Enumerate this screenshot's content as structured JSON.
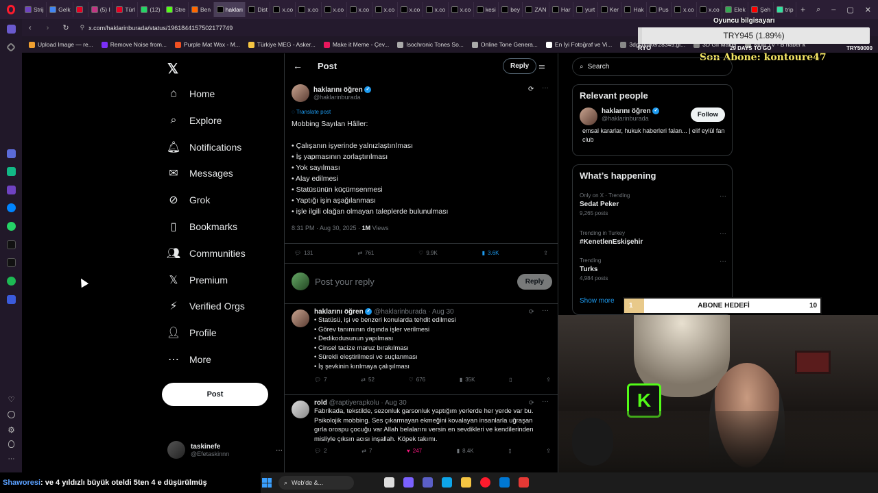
{
  "browser": {
    "tabs": [
      {
        "label": "Strij",
        "color": "#6f42c1"
      },
      {
        "label": "Gelk",
        "color": "#4285f4"
      },
      {
        "label": "",
        "color": "#e60023"
      },
      {
        "label": "(5) I",
        "color": "#c13584"
      },
      {
        "label": "Türl",
        "color": "#e60023"
      },
      {
        "label": "(12)",
        "color": "#25d366"
      },
      {
        "label": "Stre",
        "color": "#53fc18"
      },
      {
        "label": "Ben",
        "color": "#ff6600"
      },
      {
        "label": "hakları",
        "color": "#000000",
        "active": true
      },
      {
        "label": "Dist",
        "color": "#000000"
      },
      {
        "label": "x.co",
        "color": "#000000"
      },
      {
        "label": "x.co",
        "color": "#000000"
      },
      {
        "label": "x.co",
        "color": "#000000"
      },
      {
        "label": "x.co",
        "color": "#000000"
      },
      {
        "label": "x.co",
        "color": "#000000"
      },
      {
        "label": "x.co",
        "color": "#000000"
      },
      {
        "label": "x.co",
        "color": "#000000"
      },
      {
        "label": "x.co",
        "color": "#000000"
      },
      {
        "label": "kesi",
        "color": "#000000"
      },
      {
        "label": "bey",
        "color": "#000000"
      },
      {
        "label": "ZAN",
        "color": "#000000"
      },
      {
        "label": "Har",
        "color": "#000000"
      },
      {
        "label": "yurt",
        "color": "#000000"
      },
      {
        "label": "Ker",
        "color": "#000000"
      },
      {
        "label": "Hak",
        "color": "#000000"
      },
      {
        "label": "Pus",
        "color": "#000000"
      },
      {
        "label": "x.co",
        "color": "#000000"
      },
      {
        "label": "x.co",
        "color": "#000000"
      },
      {
        "label": "Elek",
        "color": "#34a853"
      },
      {
        "label": "Şeh",
        "color": "#ff0000"
      },
      {
        "label": "trip",
        "color": "#34e0a1"
      }
    ],
    "url": "x.com/haklarinburada/status/1961844157502177749",
    "bookmarks": [
      {
        "label": "Upload Image — re...",
        "color": "#f0a030"
      },
      {
        "label": "Remove Noise from...",
        "color": "#7b2ff7"
      },
      {
        "label": "Purple Mat Wax - M...",
        "color": "#f25022"
      },
      {
        "label": "Türkiye MEG - Asker...",
        "color": "#f5c542"
      },
      {
        "label": "Make it Meme - Çev...",
        "color": "#e8175d"
      },
      {
        "label": "Isochronic Tones So...",
        "color": "#aaaaaa"
      },
      {
        "label": "Online Tone Genera...",
        "color": "#aaaaaa"
      },
      {
        "label": "En İyi Fotoğraf ve Vi...",
        "color": "#ffffff"
      },
      {
        "label": "3dgifmaker28349.gi...",
        "color": "#888888"
      },
      {
        "label": "3D Gif Maker",
        "color": "#888888"
      },
      {
        "label": "Multi TV - B haber k",
        "color": "#888888"
      }
    ]
  },
  "overlay": {
    "computer_label": "Oyuncu bilgisayarı",
    "goal_value": "TRY945 (1.89%)",
    "goal_left": "RYO",
    "goal_days": "29 DAYS TO GO",
    "goal_right": "TRY50000",
    "goal_progress": 0.0189,
    "last_sub": "Son Abone: kontoure47",
    "sub_goal_current": "1",
    "sub_goal_label": "ABONE HEDEFİ",
    "sub_goal_target": "10",
    "sub_goal_progress": 0.1
  },
  "nav": {
    "items": [
      {
        "label": "Home",
        "icon": "home-icon"
      },
      {
        "label": "Explore",
        "icon": "search-icon"
      },
      {
        "label": "Notifications",
        "icon": "bell-icon"
      },
      {
        "label": "Messages",
        "icon": "mail-icon"
      },
      {
        "label": "Grok",
        "icon": "grok-icon"
      },
      {
        "label": "Bookmarks",
        "icon": "bookmark-icon"
      },
      {
        "label": "Communities",
        "icon": "people-icon"
      },
      {
        "label": "Premium",
        "icon": "x-logo-icon"
      },
      {
        "label": "Verified Orgs",
        "icon": "bolt-icon"
      },
      {
        "label": "Profile",
        "icon": "person-icon"
      },
      {
        "label": "More",
        "icon": "more-circle-icon"
      }
    ],
    "post_button": "Post",
    "account_name": "taskinefe",
    "account_handle": "@Efetaskinnn"
  },
  "main": {
    "header_title": "Post",
    "reply_button": "Reply",
    "post": {
      "author": "haklarını öğren",
      "handle": "@haklarinburada",
      "translate": "Translate post",
      "lines": [
        "Mobbing Sayılan Hâller:",
        "",
        "• Çalışanın işyerinde yalnızlaştırılması",
        "• İş yapmasının zorlaştırılması",
        "• Yok sayılması",
        "• Alay edilmesi",
        "• Statüsünün küçümsenmesi",
        "• Yaptığı işin aşağılanması",
        "• işle ilgili olağan olmayan taleplerde bulunulması"
      ],
      "time": "8:31 PM · Aug 30, 2025 · ",
      "views_count": "1M",
      "views_label": " Views",
      "replies": "131",
      "reposts": "761",
      "likes": "9.9K",
      "bookmarks": "3.6K"
    },
    "compose_placeholder": "Post your reply",
    "compose_button": "Reply",
    "replies": [
      {
        "author": "haklarını öğren",
        "handle": "@haklarinburada · Aug 30",
        "verified": true,
        "lines": [
          "• Statüsü, işi ve benzeri konularda tehdit edilmesi",
          "• Görev tanımının dışında işler verilmesi",
          "• Dedikodusunun yapılması",
          "• Cinsel tacize maruz bırakılması",
          "• Sürekli eleştirilmesi ve suçlanması",
          "• İş şevkinin kırılmaya çalışılması"
        ],
        "replies": "7",
        "reposts": "52",
        "likes": "676",
        "views": "35K"
      },
      {
        "author": "rold",
        "handle": "@raptiyerapkolu · Aug 30",
        "verified": false,
        "lines": [
          "Fabrikada, tekstilde, sezonluk garsonluk yaptığım yerlerde her yerde var bu.",
          "Psikolojik mobbing. Ses çıkarmayan ekmeğini kovalayan insanlarla uğraşan",
          "gırla orospu çocuğu var Allah belalarını versin en sevdikleri ve kendilerinden",
          "misliyle çıksın acısı inşallah. Köpek takımı."
        ],
        "replies": "2",
        "reposts": "7",
        "likes": "247",
        "views": "8.4K"
      }
    ]
  },
  "right": {
    "search_placeholder": "Search",
    "relevant_title": "Relevant people",
    "person_name": "haklarını öğren",
    "person_handle": "@haklarinburada",
    "person_bio": "emsal kararlar, hukuk haberleri falan... | elif eylül fan club",
    "follow_button": "Follow",
    "happening_title": "What’s happening",
    "trends": [
      {
        "context": "Only on X · Trending",
        "name": "Sedat Peker",
        "count": "9,265 posts"
      },
      {
        "context": "Trending in Turkey",
        "name": "#KenetlenEskişehir",
        "count": ""
      },
      {
        "context": "Trending",
        "name": "Turks",
        "count": "4,984 posts"
      }
    ],
    "show_more": "Show more"
  },
  "taskbar": {
    "ticker_name": "Shaworesi",
    "ticker_text": ": ve 4 yıldızlı büyük oteldi 5ten 4 e düşürülmüş",
    "search_label": "Web'de &..."
  },
  "colors": {
    "accent": "#1d9bf0",
    "like": "#f91880",
    "overlay_yellow": "#f5e663"
  }
}
